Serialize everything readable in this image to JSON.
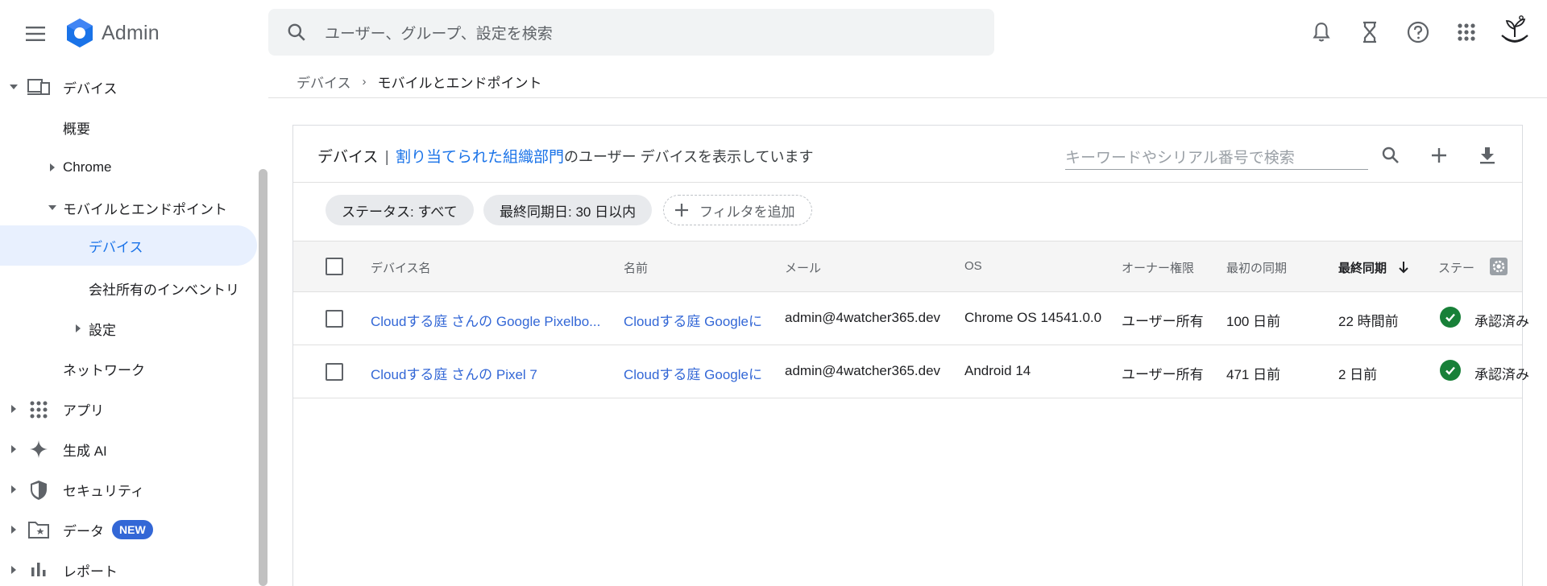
{
  "app": {
    "title": "Admin"
  },
  "search": {
    "placeholder": "ユーザー、グループ、設定を検索"
  },
  "sidebar": {
    "items": [
      {
        "label": "デバイス"
      },
      {
        "label": "概要"
      },
      {
        "label": "Chrome"
      },
      {
        "label": "モバイルとエンドポイント"
      },
      {
        "label": "デバイス"
      },
      {
        "label": "会社所有のインベントリ"
      },
      {
        "label": "設定"
      },
      {
        "label": "ネットワーク"
      },
      {
        "label": "アプリ"
      },
      {
        "label": "生成 AI"
      },
      {
        "label": "セキュリティ"
      },
      {
        "label": "データ",
        "badge": "NEW"
      },
      {
        "label": "レポート"
      }
    ]
  },
  "breadcrumb": {
    "parent": "デバイス",
    "separator": "›",
    "current": "モバイルとエンドポイント"
  },
  "card": {
    "title": "デバイス",
    "title_sep": "|",
    "org_link": "割り当てられた組織部門",
    "title_rest": "のユーザー デバイスを表示しています",
    "search_placeholder": "キーワードやシリアル番号で検索"
  },
  "filters": {
    "status": "ステータス: すべて",
    "last_sync": "最終同期日: 30 日以内",
    "add": "フィルタを追加"
  },
  "table": {
    "columns": [
      "デバイス名",
      "名前",
      "メール",
      "OS",
      "オーナー権限",
      "最初の同期",
      "最終同期",
      "ステー"
    ],
    "rows": [
      {
        "device": "Cloudする庭 さんの Google Pixelbo...",
        "name": "Cloudする庭 Googleに",
        "email": "admin@4watcher365.dev",
        "os": "Chrome OS 14541.0.0",
        "owner": "ユーザー所有",
        "first_sync": "100 日前",
        "last_sync": "22 時間前",
        "status": "承認済み"
      },
      {
        "device": "Cloudする庭 さんの Pixel 7",
        "name": "Cloudする庭 Googleに",
        "email": "admin@4watcher365.dev",
        "os": "Android 14",
        "owner": "ユーザー所有",
        "first_sync": "471 日前",
        "last_sync": "2 日前",
        "status": "承認済み"
      }
    ]
  },
  "colors": {
    "accent": "#1a73e8",
    "link": "#3367d6",
    "active_bg": "#e8f0fe",
    "success": "#188038"
  }
}
